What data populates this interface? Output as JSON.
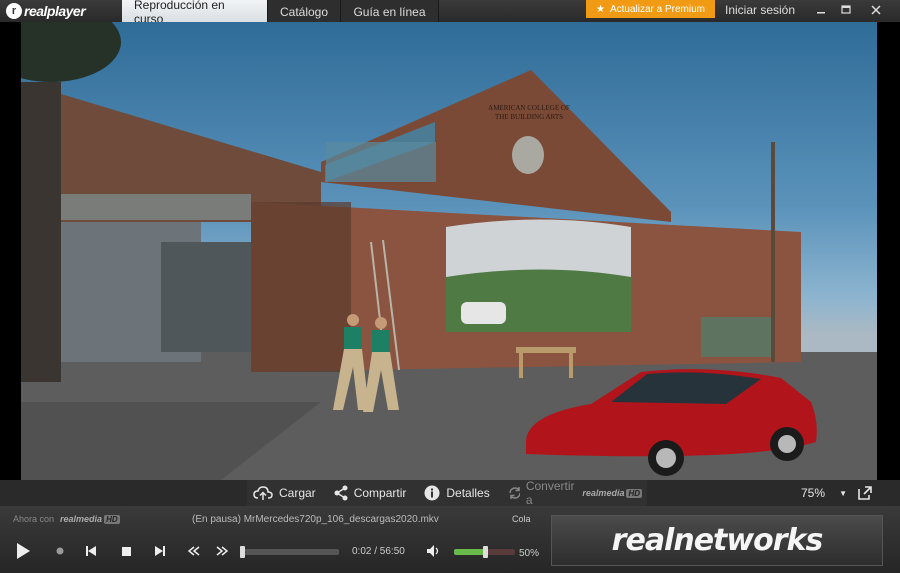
{
  "app": {
    "logo_text": "realplayer",
    "tabs": [
      {
        "label": "Reproducción en curso",
        "active": true
      },
      {
        "label": "Catálogo",
        "active": false
      },
      {
        "label": "Guía en línea",
        "active": false
      }
    ],
    "premium_label": "Actualizar a Premium",
    "signin_label": "Iniciar sesión",
    "colors": {
      "accent": "#f19b15",
      "active_tab": "#e8ecf0"
    }
  },
  "video": {
    "mural_text": "AMERICAN COLLEGE OF THE BUILDING ARTS",
    "scene_icons": [
      "building",
      "car",
      "people"
    ]
  },
  "strip": {
    "upload_label": "Cargar",
    "share_label": "Compartir",
    "details_label": "Detalles",
    "convert_label": "Convertir a",
    "convert_brand": "realmedia",
    "convert_badge": "HD",
    "zoom": "75%"
  },
  "player": {
    "now_label": "Ahora con",
    "now_brand": "realmedia",
    "now_badge": "HD",
    "file_status": "(En pausa) MrMercedes720p_106_descargas2020.mkv",
    "queue_label": "Cola",
    "time": "0:02 / 56:50",
    "progress": 0.0006,
    "volume": 0.5,
    "volume_label": "50%",
    "brand": "realnetworks"
  }
}
